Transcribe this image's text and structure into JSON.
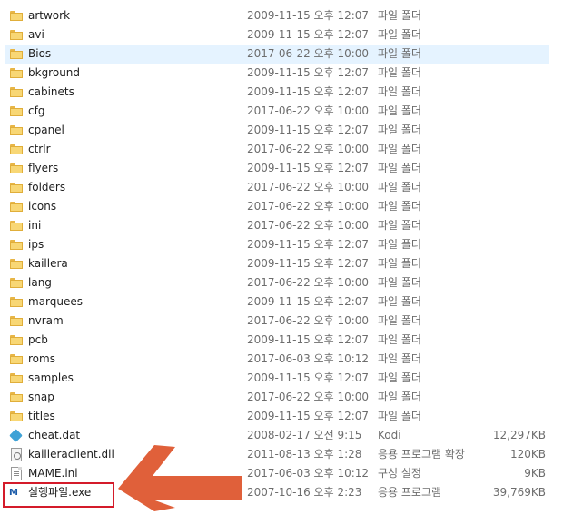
{
  "files": [
    {
      "name": "artwork",
      "date": "2009-11-15 오후 12:07",
      "type": "파일 폴더",
      "size": "",
      "icon": "folder-icon",
      "selected": false
    },
    {
      "name": "avi",
      "date": "2009-11-15 오후 12:07",
      "type": "파일 폴더",
      "size": "",
      "icon": "folder-icon",
      "selected": false
    },
    {
      "name": "Bios",
      "date": "2017-06-22 오후 10:00",
      "type": "파일 폴더",
      "size": "",
      "icon": "folder-icon",
      "selected": true
    },
    {
      "name": "bkground",
      "date": "2009-11-15 오후 12:07",
      "type": "파일 폴더",
      "size": "",
      "icon": "folder-icon",
      "selected": false
    },
    {
      "name": "cabinets",
      "date": "2009-11-15 오후 12:07",
      "type": "파일 폴더",
      "size": "",
      "icon": "folder-icon",
      "selected": false
    },
    {
      "name": "cfg",
      "date": "2017-06-22 오후 10:00",
      "type": "파일 폴더",
      "size": "",
      "icon": "folder-icon",
      "selected": false
    },
    {
      "name": "cpanel",
      "date": "2009-11-15 오후 12:07",
      "type": "파일 폴더",
      "size": "",
      "icon": "folder-icon",
      "selected": false
    },
    {
      "name": "ctrlr",
      "date": "2017-06-22 오후 10:00",
      "type": "파일 폴더",
      "size": "",
      "icon": "folder-icon",
      "selected": false
    },
    {
      "name": "flyers",
      "date": "2009-11-15 오후 12:07",
      "type": "파일 폴더",
      "size": "",
      "icon": "folder-icon",
      "selected": false
    },
    {
      "name": "folders",
      "date": "2017-06-22 오후 10:00",
      "type": "파일 폴더",
      "size": "",
      "icon": "folder-icon",
      "selected": false
    },
    {
      "name": "icons",
      "date": "2017-06-22 오후 10:00",
      "type": "파일 폴더",
      "size": "",
      "icon": "folder-icon",
      "selected": false
    },
    {
      "name": "ini",
      "date": "2017-06-22 오후 10:00",
      "type": "파일 폴더",
      "size": "",
      "icon": "folder-icon",
      "selected": false
    },
    {
      "name": "ips",
      "date": "2009-11-15 오후 12:07",
      "type": "파일 폴더",
      "size": "",
      "icon": "folder-icon",
      "selected": false
    },
    {
      "name": "kaillera",
      "date": "2009-11-15 오후 12:07",
      "type": "파일 폴더",
      "size": "",
      "icon": "folder-icon",
      "selected": false
    },
    {
      "name": "lang",
      "date": "2017-06-22 오후 10:00",
      "type": "파일 폴더",
      "size": "",
      "icon": "folder-icon",
      "selected": false
    },
    {
      "name": "marquees",
      "date": "2009-11-15 오후 12:07",
      "type": "파일 폴더",
      "size": "",
      "icon": "folder-icon",
      "selected": false
    },
    {
      "name": "nvram",
      "date": "2017-06-22 오후 10:00",
      "type": "파일 폴더",
      "size": "",
      "icon": "folder-icon",
      "selected": false
    },
    {
      "name": "pcb",
      "date": "2009-11-15 오후 12:07",
      "type": "파일 폴더",
      "size": "",
      "icon": "folder-icon",
      "selected": false
    },
    {
      "name": "roms",
      "date": "2017-06-03 오후 10:12",
      "type": "파일 폴더",
      "size": "",
      "icon": "folder-icon",
      "selected": false
    },
    {
      "name": "samples",
      "date": "2009-11-15 오후 12:07",
      "type": "파일 폴더",
      "size": "",
      "icon": "folder-icon",
      "selected": false
    },
    {
      "name": "snap",
      "date": "2017-06-22 오후 10:00",
      "type": "파일 폴더",
      "size": "",
      "icon": "folder-icon",
      "selected": false
    },
    {
      "name": "titles",
      "date": "2009-11-15 오후 12:07",
      "type": "파일 폴더",
      "size": "",
      "icon": "folder-icon",
      "selected": false
    },
    {
      "name": "cheat.dat",
      "date": "2008-02-17 오전 9:15",
      "type": "Kodi",
      "size": "12,297KB",
      "icon": "kodi-icon",
      "selected": false
    },
    {
      "name": "kailleraclient.dll",
      "date": "2011-08-13 오후 1:28",
      "type": "응용 프로그램 확장",
      "size": "120KB",
      "icon": "dll-icon",
      "selected": false
    },
    {
      "name": "MAME.ini",
      "date": "2017-06-03 오후 10:12",
      "type": "구성 설정",
      "size": "9KB",
      "icon": "ini-icon",
      "selected": false
    },
    {
      "name": "실행파일.exe",
      "date": "2007-10-16 오후 2:23",
      "type": "응용 프로그램",
      "size": "39,769KB",
      "icon": "mame-icon",
      "selected": false
    }
  ],
  "icon_text": {
    "mame": "M"
  },
  "colors": {
    "selection": "#e5f3ff",
    "folder": "#f8d775",
    "annotation_red": "#d41b2a",
    "arrow": "#e0603a"
  }
}
